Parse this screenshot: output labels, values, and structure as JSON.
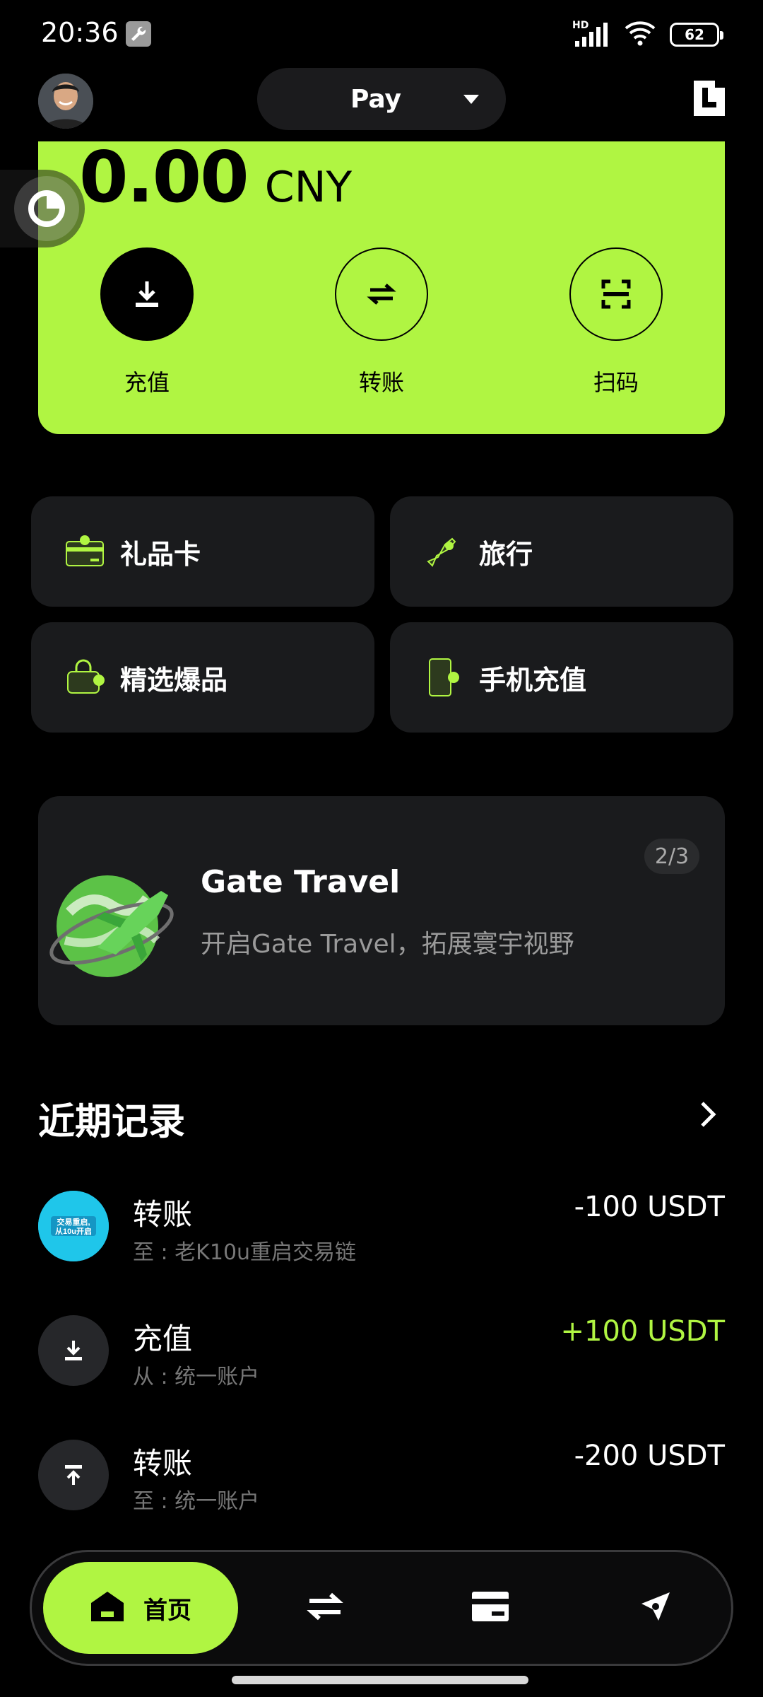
{
  "status_bar": {
    "time": "20:36",
    "network": "HD",
    "battery": "62"
  },
  "header": {
    "mode_label": "Pay"
  },
  "balance": {
    "amount": "0.00",
    "currency": "CNY"
  },
  "actions": [
    {
      "label": "充值",
      "icon": "download-icon"
    },
    {
      "label": "转账",
      "icon": "transfer-icon"
    },
    {
      "label": "扫码",
      "icon": "scan-icon"
    }
  ],
  "services": [
    {
      "label": "礼品卡",
      "icon": "gift-card-icon"
    },
    {
      "label": "旅行",
      "icon": "plane-icon"
    },
    {
      "label": "精选爆品",
      "icon": "shopping-bag-icon"
    },
    {
      "label": "手机充值",
      "icon": "phone-icon"
    }
  ],
  "banner": {
    "title": "Gate Travel",
    "subtitle": "开启Gate Travel，拓展寰宇视野",
    "page": "2/3"
  },
  "records": {
    "title": "近期记录",
    "items": [
      {
        "name": "转账",
        "detail": "至 : 老K10u重启交易链",
        "amount": "-100 USDT",
        "positive": false,
        "avatar_text": "交易重启，从10u开启"
      },
      {
        "name": "充值",
        "detail": "从 : 统一账户",
        "amount": "+100 USDT",
        "positive": true
      },
      {
        "name": "转账",
        "detail": "至 : 统一账户",
        "amount": "-200 USDT",
        "positive": false
      }
    ]
  },
  "nav": {
    "home_label": "首页"
  },
  "colors": {
    "accent": "#b0f542",
    "card": "#1a1b1d",
    "background": "#000000"
  }
}
